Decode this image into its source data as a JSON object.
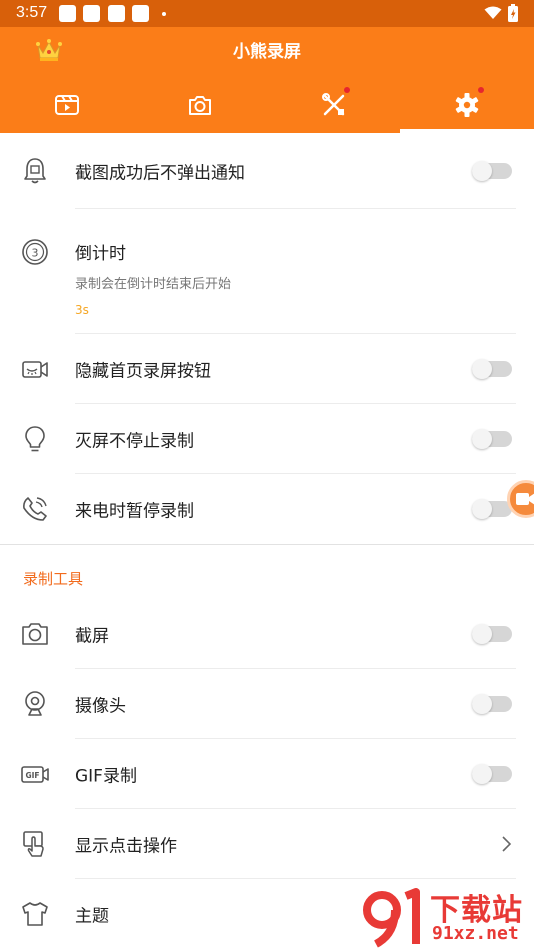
{
  "status_bar": {
    "time": "3:57"
  },
  "app": {
    "title": "小熊录屏",
    "accent_color": "#fb7d18",
    "tabs": [
      {
        "icon": "film-icon",
        "has_badge": false
      },
      {
        "icon": "camera-icon",
        "has_badge": false
      },
      {
        "icon": "tools-icon",
        "has_badge": true
      },
      {
        "icon": "gear-icon",
        "has_badge": true,
        "selected": true
      }
    ]
  },
  "settings": {
    "screenshot_notify": {
      "label": "截图成功后不弹出通知",
      "enabled": false
    },
    "countdown": {
      "label": "倒计时",
      "description": "录制会在倒计时结束后开始",
      "value": "3s"
    },
    "hide_home_button": {
      "label": "隐藏首页录屏按钮",
      "enabled": false
    },
    "screen_off_record": {
      "label": "灭屏不停止录制",
      "enabled": false
    },
    "pause_on_call": {
      "label": "来电时暂停录制",
      "enabled": false
    }
  },
  "record_tools": {
    "header": "录制工具",
    "screenshot": {
      "label": "截屏",
      "enabled": false
    },
    "camera": {
      "label": "摄像头",
      "enabled": false
    },
    "gif": {
      "label": "GIF录制",
      "enabled": false
    },
    "show_touches": {
      "label": "显示点击操作"
    },
    "theme": {
      "label": "主题"
    }
  },
  "watermark": {
    "line1": "下载站",
    "line2": "91xz.net"
  }
}
